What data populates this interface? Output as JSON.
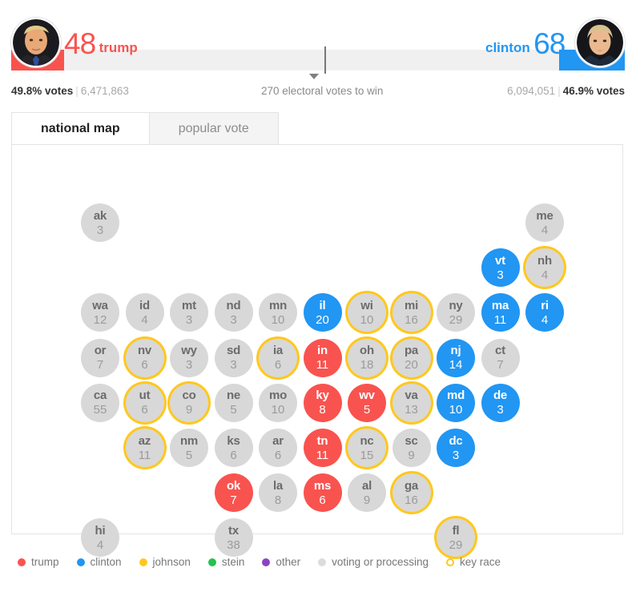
{
  "header": {
    "trump": {
      "name": "trump",
      "electoral_votes": "48",
      "pct_label": "49.8% votes",
      "popular_votes": "6,471,863",
      "color": "#f9534f",
      "avatar": "trump-avatar"
    },
    "clinton": {
      "name": "clinton",
      "electoral_votes": "68",
      "pct_label": "46.9% votes",
      "popular_votes": "6,094,051",
      "color": "#2196f3",
      "avatar": "clinton-avatar"
    },
    "center_caption": "270 electoral votes to win",
    "separator": "|"
  },
  "tabs": [
    {
      "label": "national map",
      "active": true
    },
    {
      "label": "popular vote",
      "active": false
    }
  ],
  "map": {
    "states": [
      {
        "ab": "ak",
        "ev": "3",
        "status": "none",
        "key": false,
        "col": 0,
        "row": 0
      },
      {
        "ab": "me",
        "ev": "4",
        "status": "none",
        "key": false,
        "col": 10,
        "row": 0
      },
      {
        "ab": "vt",
        "ev": "3",
        "status": "clinton",
        "key": false,
        "col": 9,
        "row": 1
      },
      {
        "ab": "nh",
        "ev": "4",
        "status": "none",
        "key": true,
        "col": 10,
        "row": 1
      },
      {
        "ab": "wa",
        "ev": "12",
        "status": "none",
        "key": false,
        "col": 0,
        "row": 2
      },
      {
        "ab": "id",
        "ev": "4",
        "status": "none",
        "key": false,
        "col": 1,
        "row": 2
      },
      {
        "ab": "mt",
        "ev": "3",
        "status": "none",
        "key": false,
        "col": 2,
        "row": 2
      },
      {
        "ab": "nd",
        "ev": "3",
        "status": "none",
        "key": false,
        "col": 3,
        "row": 2
      },
      {
        "ab": "mn",
        "ev": "10",
        "status": "none",
        "key": false,
        "col": 4,
        "row": 2
      },
      {
        "ab": "il",
        "ev": "20",
        "status": "clinton",
        "key": false,
        "col": 5,
        "row": 2
      },
      {
        "ab": "wi",
        "ev": "10",
        "status": "none",
        "key": true,
        "col": 6,
        "row": 2
      },
      {
        "ab": "mi",
        "ev": "16",
        "status": "none",
        "key": true,
        "col": 7,
        "row": 2
      },
      {
        "ab": "ny",
        "ev": "29",
        "status": "none",
        "key": false,
        "col": 8,
        "row": 2
      },
      {
        "ab": "ma",
        "ev": "11",
        "status": "clinton",
        "key": false,
        "col": 9,
        "row": 2
      },
      {
        "ab": "ri",
        "ev": "4",
        "status": "clinton",
        "key": false,
        "col": 10,
        "row": 2
      },
      {
        "ab": "or",
        "ev": "7",
        "status": "none",
        "key": false,
        "col": 0,
        "row": 3
      },
      {
        "ab": "nv",
        "ev": "6",
        "status": "none",
        "key": true,
        "col": 1,
        "row": 3
      },
      {
        "ab": "wy",
        "ev": "3",
        "status": "none",
        "key": false,
        "col": 2,
        "row": 3
      },
      {
        "ab": "sd",
        "ev": "3",
        "status": "none",
        "key": false,
        "col": 3,
        "row": 3
      },
      {
        "ab": "ia",
        "ev": "6",
        "status": "none",
        "key": true,
        "col": 4,
        "row": 3
      },
      {
        "ab": "in",
        "ev": "11",
        "status": "trump",
        "key": false,
        "col": 5,
        "row": 3
      },
      {
        "ab": "oh",
        "ev": "18",
        "status": "none",
        "key": true,
        "col": 6,
        "row": 3
      },
      {
        "ab": "pa",
        "ev": "20",
        "status": "none",
        "key": true,
        "col": 7,
        "row": 3
      },
      {
        "ab": "nj",
        "ev": "14",
        "status": "clinton",
        "key": false,
        "col": 8,
        "row": 3
      },
      {
        "ab": "ct",
        "ev": "7",
        "status": "none",
        "key": false,
        "col": 9,
        "row": 3
      },
      {
        "ab": "ca",
        "ev": "55",
        "status": "none",
        "key": false,
        "col": 0,
        "row": 4
      },
      {
        "ab": "ut",
        "ev": "6",
        "status": "none",
        "key": true,
        "col": 1,
        "row": 4
      },
      {
        "ab": "co",
        "ev": "9",
        "status": "none",
        "key": true,
        "col": 2,
        "row": 4
      },
      {
        "ab": "ne",
        "ev": "5",
        "status": "none",
        "key": false,
        "col": 3,
        "row": 4
      },
      {
        "ab": "mo",
        "ev": "10",
        "status": "none",
        "key": false,
        "col": 4,
        "row": 4
      },
      {
        "ab": "ky",
        "ev": "8",
        "status": "trump",
        "key": false,
        "col": 5,
        "row": 4
      },
      {
        "ab": "wv",
        "ev": "5",
        "status": "trump",
        "key": false,
        "col": 6,
        "row": 4
      },
      {
        "ab": "va",
        "ev": "13",
        "status": "none",
        "key": true,
        "col": 7,
        "row": 4
      },
      {
        "ab": "md",
        "ev": "10",
        "status": "clinton",
        "key": false,
        "col": 8,
        "row": 4
      },
      {
        "ab": "de",
        "ev": "3",
        "status": "clinton",
        "key": false,
        "col": 9,
        "row": 4
      },
      {
        "ab": "az",
        "ev": "11",
        "status": "none",
        "key": true,
        "col": 1,
        "row": 5
      },
      {
        "ab": "nm",
        "ev": "5",
        "status": "none",
        "key": false,
        "col": 2,
        "row": 5
      },
      {
        "ab": "ks",
        "ev": "6",
        "status": "none",
        "key": false,
        "col": 3,
        "row": 5
      },
      {
        "ab": "ar",
        "ev": "6",
        "status": "none",
        "key": false,
        "col": 4,
        "row": 5
      },
      {
        "ab": "tn",
        "ev": "11",
        "status": "trump",
        "key": false,
        "col": 5,
        "row": 5
      },
      {
        "ab": "nc",
        "ev": "15",
        "status": "none",
        "key": true,
        "col": 6,
        "row": 5
      },
      {
        "ab": "sc",
        "ev": "9",
        "status": "none",
        "key": false,
        "col": 7,
        "row": 5
      },
      {
        "ab": "dc",
        "ev": "3",
        "status": "clinton",
        "key": false,
        "col": 8,
        "row": 5
      },
      {
        "ab": "ok",
        "ev": "7",
        "status": "trump",
        "key": false,
        "col": 3,
        "row": 6
      },
      {
        "ab": "la",
        "ev": "8",
        "status": "none",
        "key": false,
        "col": 4,
        "row": 6
      },
      {
        "ab": "ms",
        "ev": "6",
        "status": "trump",
        "key": false,
        "col": 5,
        "row": 6
      },
      {
        "ab": "al",
        "ev": "9",
        "status": "none",
        "key": false,
        "col": 6,
        "row": 6
      },
      {
        "ab": "ga",
        "ev": "16",
        "status": "none",
        "key": true,
        "col": 7,
        "row": 6
      },
      {
        "ab": "hi",
        "ev": "4",
        "status": "none",
        "key": false,
        "col": 0,
        "row": 7
      },
      {
        "ab": "tx",
        "ev": "38",
        "status": "none",
        "key": false,
        "col": 3,
        "row": 7
      },
      {
        "ab": "fl",
        "ev": "29",
        "status": "none",
        "key": true,
        "col": 8,
        "row": 7
      }
    ]
  },
  "legend": [
    {
      "label": "trump",
      "color": "#f9534f",
      "ring": false
    },
    {
      "label": "clinton",
      "color": "#2196f3",
      "ring": false
    },
    {
      "label": "johnson",
      "color": "#ffc81e",
      "ring": false
    },
    {
      "label": "stein",
      "color": "#24c24c",
      "ring": false
    },
    {
      "label": "other",
      "color": "#8b43c4",
      "ring": false
    },
    {
      "label": "voting or processing",
      "color": "#dcdcdc",
      "ring": false
    },
    {
      "label": "key race",
      "color": "#ffc81e",
      "ring": true
    }
  ]
}
